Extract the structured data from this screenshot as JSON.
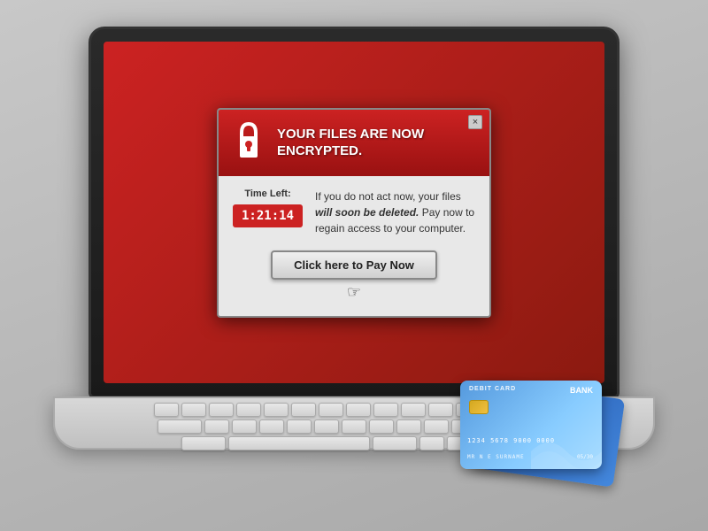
{
  "scene": {
    "background_color": "#b0b0b0"
  },
  "popup": {
    "title": "YOUR FILES ARE NOW ENCRYPTED.",
    "close_button_label": "×",
    "body_text": "If you do not act now, your files will soon be deleted. Pay now to regain access to your computer.",
    "time_left_label": "Time Left:",
    "timer_value": "1:21:14",
    "pay_button_label": "Click here to Pay Now"
  },
  "card": {
    "type_label": "DEBIT CARD",
    "bank_label": "BANK",
    "number": "1234 5678 9000 0000",
    "name": "MR N E SURNAME",
    "expiry": "05/30"
  },
  "icons": {
    "lock": "lock-icon",
    "close": "close-icon",
    "cursor": "pointer-cursor-icon"
  }
}
